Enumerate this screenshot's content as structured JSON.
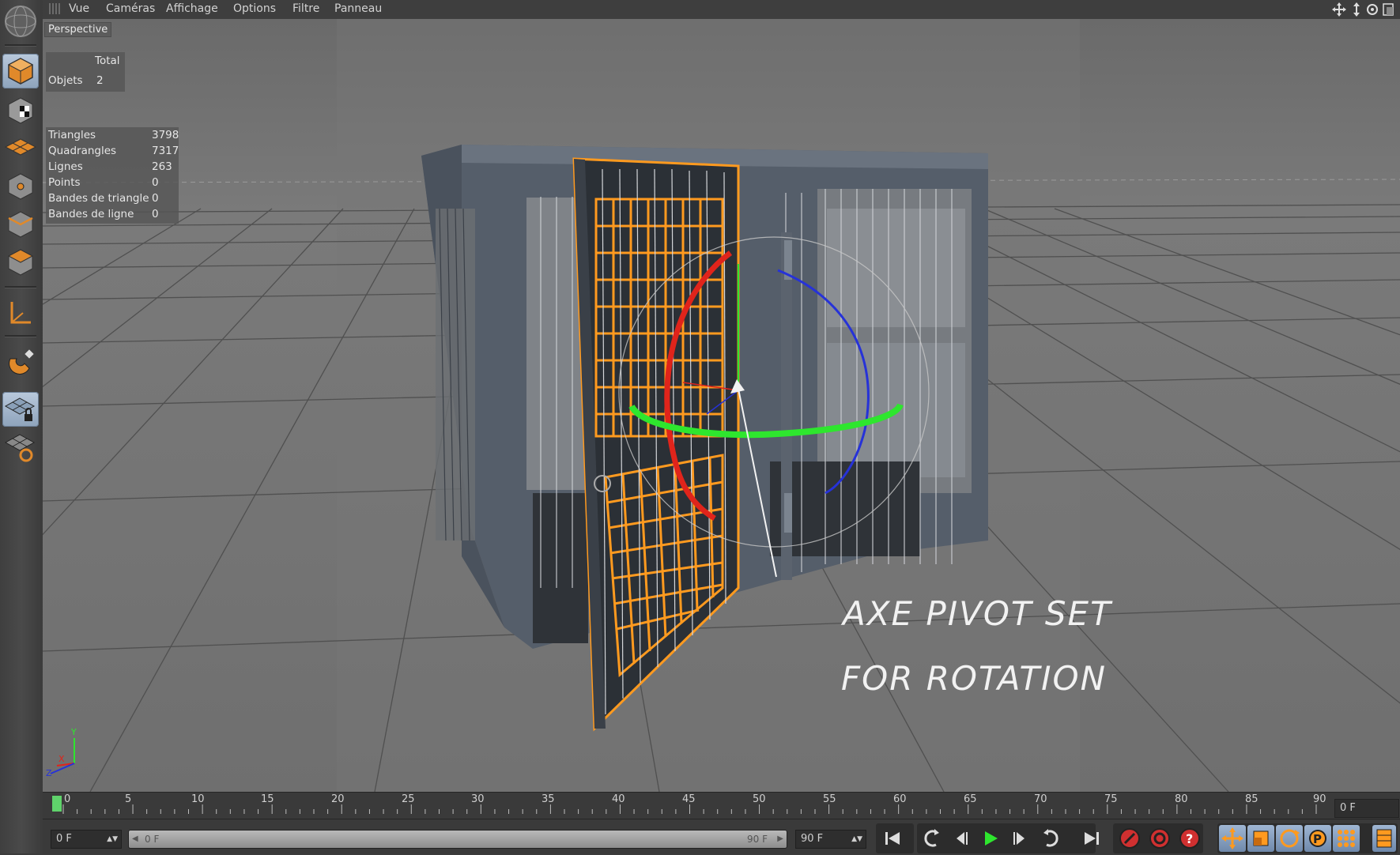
{
  "menu": {
    "items": [
      "Vue",
      "Caméras",
      "Affichage",
      "Options",
      "Filtre",
      "Panneau"
    ]
  },
  "viewport": {
    "label": "Perspective",
    "objects_panel": {
      "header": "Total",
      "rows": [
        {
          "label": "Objets",
          "value": "2"
        }
      ]
    },
    "stats_panel": {
      "rows": [
        {
          "label": "Triangles",
          "value": "3798"
        },
        {
          "label": "Quadrangles",
          "value": "7317"
        },
        {
          "label": "Lignes",
          "value": "263"
        },
        {
          "label": "Points",
          "value": "0"
        },
        {
          "label": "Bandes de triangle",
          "value": "0"
        },
        {
          "label": "Bandes de ligne",
          "value": "0"
        }
      ]
    },
    "annotation": {
      "line1": "AXE PIVOT SET",
      "line2": "FOR ROTATION"
    },
    "axis_labels": {
      "y": "Y",
      "x": "X",
      "z": "Z"
    }
  },
  "timeline": {
    "ticks": [
      "0",
      "5",
      "10",
      "15",
      "20",
      "25",
      "30",
      "35",
      "40",
      "45",
      "50",
      "55",
      "60",
      "65",
      "70",
      "75",
      "80",
      "85",
      "90"
    ],
    "current_frame_field": "0 F"
  },
  "transport": {
    "start_field": "0 F",
    "range_start": "0 F",
    "range_end": "90 F",
    "end_field": "90 F"
  },
  "colors": {
    "accent": "#ff9a1f",
    "axis_red": "#e0241b",
    "axis_green": "#2ee62e",
    "axis_blue": "#2632d8",
    "playhead": "#5fd36b"
  },
  "icons": {
    "left_toolbar": [
      "app-logo-icon",
      "model-mode-icon",
      "texture-mode-icon",
      "workplane-mode-icon",
      "points-mode-icon",
      "edges-mode-icon",
      "polygons-mode-icon",
      "axis-mode-icon",
      "magnet-icon",
      "workplane-lock-icon",
      "workplane-snap-icon"
    ],
    "transport": [
      "go-start-icon",
      "prev-key-icon",
      "prev-frame-icon",
      "play-icon",
      "next-frame-icon",
      "next-key-icon",
      "go-end-icon",
      "record-icon",
      "autokey-icon",
      "keyframe-selection-icon",
      "move-icon",
      "scale-icon",
      "rotate-icon",
      "param-icon",
      "pla-icon",
      "timeline-icon"
    ]
  }
}
